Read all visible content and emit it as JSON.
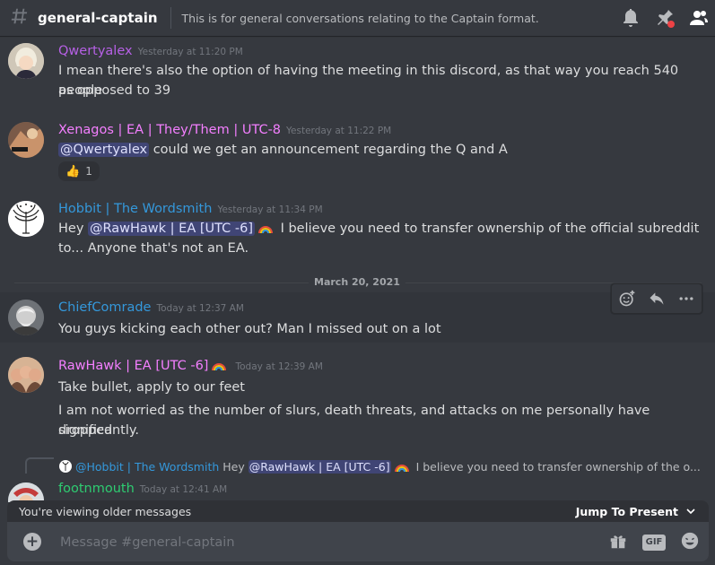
{
  "header": {
    "channel_name": "general-captain",
    "topic": "This is for general conversations relating to the Captain format."
  },
  "messages": [
    {
      "author": "Qwertyalex",
      "author_color": "#b660e5",
      "timestamp": "Yesterday at 11:20 PM",
      "lines": [
        "I mean there's also the option of having the meeting in this discord, as that way you reach 540 people",
        "as opposed to 39"
      ]
    },
    {
      "author": "Xenagos | EA | They/Them | UTC-8",
      "author_color": "#f47fff",
      "timestamp": "Yesterday at 11:22 PM",
      "mention": "@Qwertyalex",
      "text_after_mention": " could we get an announcement regarding the Q and A",
      "reaction_emoji": "👍",
      "reaction_count": "1"
    },
    {
      "author": "Hobbit | The Wordsmith",
      "author_color": "#3498db",
      "timestamp": "Yesterday at 11:34 PM",
      "prefix": "Hey ",
      "mention": "@RawHawk | EA [UTC -6]",
      "text_after_emoji": " I believe you need to transfer ownership of the official subreddit",
      "line2": "to... Anyone that's not an EA."
    },
    {
      "author": "ChiefComrade",
      "author_color": "#3498db",
      "timestamp": "Today at 12:37 AM",
      "text": "You guys kicking each other out? Man I missed out on a lot"
    },
    {
      "author": "RawHawk | EA [UTC -6]",
      "author_color": "#f47fff",
      "timestamp": "Today at 12:39 AM",
      "line1": "Take bullet, apply to our feet",
      "line2": "I am not worried as the number of slurs, death threats, and attacks on me personally have dropped",
      "line3": "significantly."
    },
    {
      "author": "footnmouth",
      "author_color": "#2ecc71",
      "timestamp": "Today at 12:41 AM",
      "reply": {
        "author": "@Hobbit | The Wordsmith",
        "prefix": " Hey ",
        "mention": "@RawHawk | EA [UTC -6]",
        "text": " I believe you need to transfer ownership of the o..."
      }
    }
  ],
  "date_divider": "March 20, 2021",
  "older_bar": {
    "text": "You're viewing older messages",
    "jump_label": "Jump To Present"
  },
  "composer": {
    "placeholder": "Message #general-captain",
    "gif_label": "GIF"
  },
  "colors": {
    "background": "#36393f",
    "mention_bg": "#5865f2"
  }
}
